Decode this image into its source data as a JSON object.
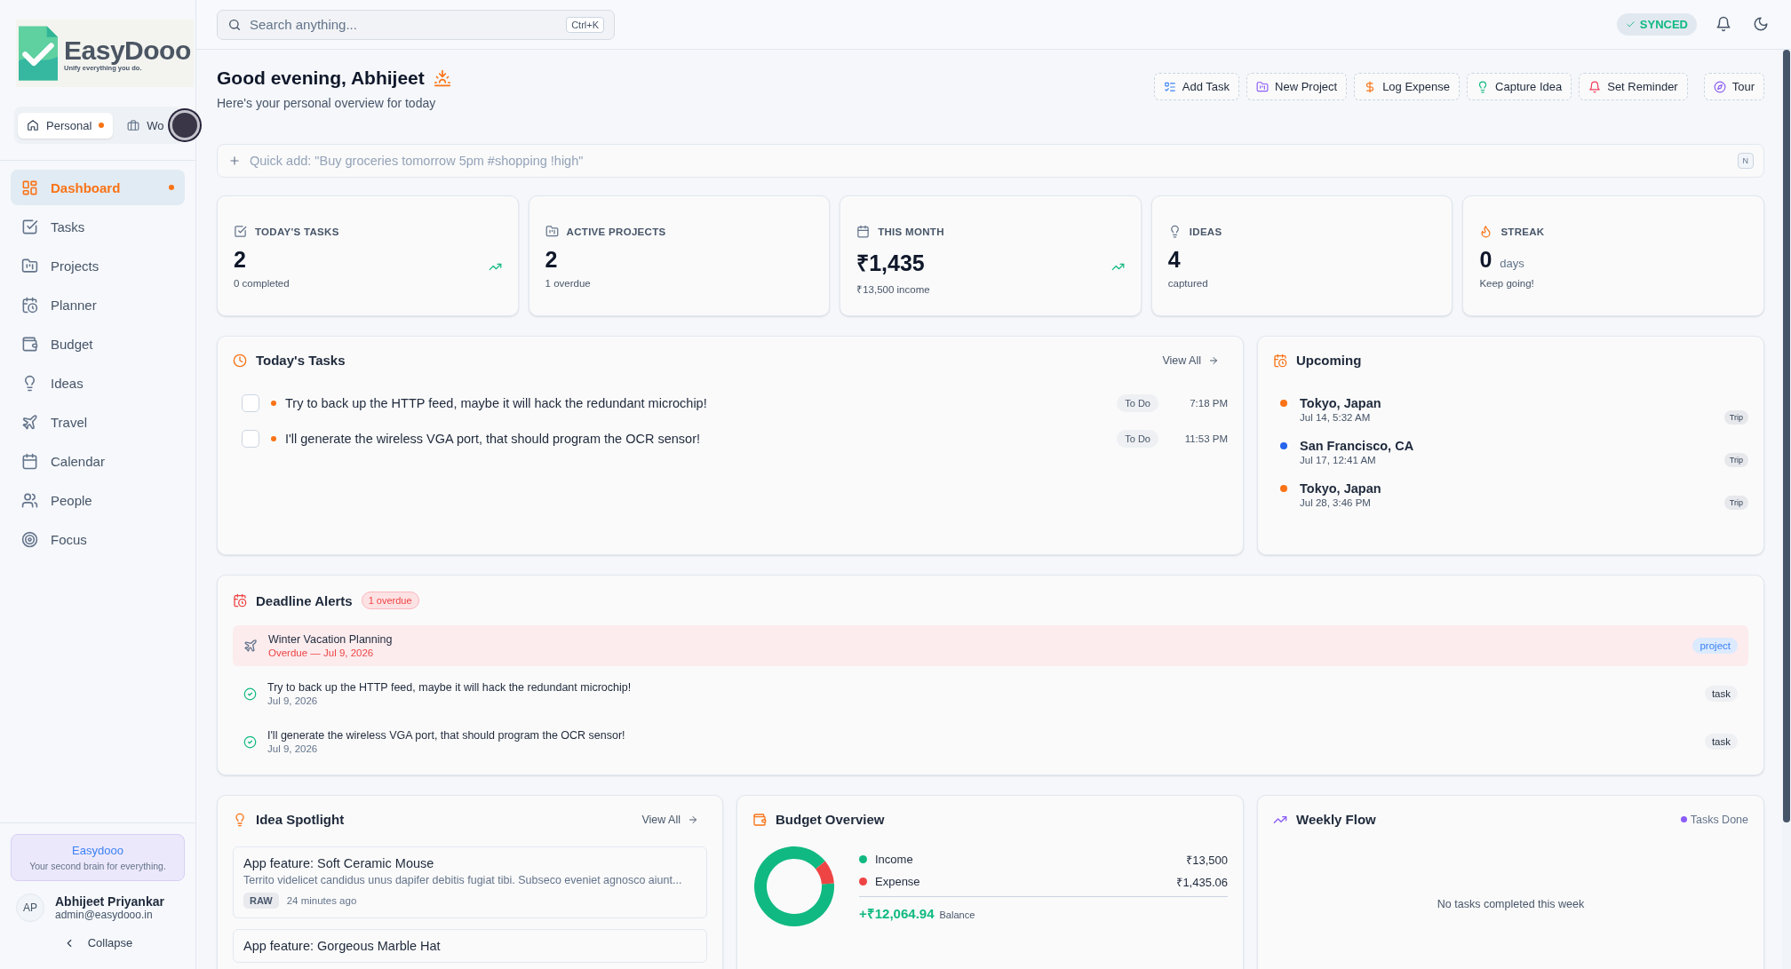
{
  "brand": {
    "name": "EasyDooo",
    "tagline": "Unify everything you do."
  },
  "workspaces": [
    {
      "label": "Personal",
      "selected": true,
      "unread": true
    },
    {
      "label": "Wo",
      "selected": false,
      "unread": false
    }
  ],
  "nav": [
    {
      "label": "Dashboard",
      "selected": true,
      "unread": true
    },
    {
      "label": "Tasks",
      "selected": false,
      "unread": false
    },
    {
      "label": "Projects",
      "selected": false,
      "unread": false
    },
    {
      "label": "Planner",
      "selected": false,
      "unread": false
    },
    {
      "label": "Budget",
      "selected": false,
      "unread": false
    },
    {
      "label": "Ideas",
      "selected": false,
      "unread": false
    },
    {
      "label": "Travel",
      "selected": false,
      "unread": false
    },
    {
      "label": "Calendar",
      "selected": false,
      "unread": false
    },
    {
      "label": "People",
      "selected": false,
      "unread": false
    },
    {
      "label": "Focus",
      "selected": false,
      "unread": false
    }
  ],
  "promo": {
    "title": "Easydooo",
    "text": "Your second brain for everything."
  },
  "user": {
    "initials": "AP",
    "name": "Abhijeet Priyankar",
    "email": "admin@easydooo.in"
  },
  "collapse": "Collapse",
  "search": {
    "placeholder": "Search anything...",
    "shortcut": "Ctrl+K"
  },
  "sync": "SYNCED",
  "greeting": {
    "title": "Good evening, Abhijeet",
    "subtitle": "Here's your personal overview for today"
  },
  "actions": [
    {
      "label": "Add Task"
    },
    {
      "label": "New Project"
    },
    {
      "label": "Log Expense"
    },
    {
      "label": "Capture Idea"
    },
    {
      "label": "Set Reminder"
    },
    {
      "label": "Tour"
    }
  ],
  "quick_add": {
    "placeholder": "Quick add: \"Buy groceries tomorrow 5pm #shopping !high\"",
    "shortcut": "N"
  },
  "stats": [
    {
      "label": "TODAY'S TASKS",
      "value": "2",
      "note": "0 completed",
      "trend": true
    },
    {
      "label": "ACTIVE PROJECTS",
      "value": "2",
      "note": "1 overdue",
      "trend": false
    },
    {
      "label": "THIS MONTH",
      "value": "₹1,435",
      "note": "₹13,500 income",
      "trend": true
    },
    {
      "label": "IDEAS",
      "value": "4",
      "note": "captured",
      "trend": false
    },
    {
      "label": "STREAK",
      "value": "0",
      "unit": "days",
      "note": "Keep going!",
      "trend": false
    }
  ],
  "today_tasks": {
    "title": "Today's Tasks",
    "view_all": "View All",
    "items": [
      {
        "text": "Try to back up the HTTP feed, maybe it will hack the redundant microchip!",
        "status": "To Do",
        "time": "7:18 PM",
        "checked": false,
        "color": "#f97316"
      },
      {
        "text": "I'll generate the wireless VGA port, that should program the OCR sensor!",
        "status": "To Do",
        "time": "11:53 PM",
        "checked": false,
        "color": "#f97316"
      }
    ]
  },
  "upcoming": {
    "title": "Upcoming",
    "items": [
      {
        "title": "Tokyo, Japan",
        "time": "Jul 14, 5:32 AM",
        "tag": "Trip",
        "color": "#f97316"
      },
      {
        "title": "San Francisco, CA",
        "time": "Jul 17, 12:41 AM",
        "tag": "Trip",
        "color": "#2563eb"
      },
      {
        "title": "Tokyo, Japan",
        "time": "Jul 28, 3:46 PM",
        "tag": "Trip",
        "color": "#f97316"
      }
    ]
  },
  "deadlines": {
    "title": "Deadline Alerts",
    "badge": "1 overdue",
    "items": [
      {
        "kind": "project",
        "title": "Winter Vacation Planning",
        "date": "Overdue — Jul 9, 2026",
        "tag": "project",
        "overdue": true
      },
      {
        "kind": "task",
        "title": "Try to back up the HTTP feed, maybe it will hack the redundant microchip!",
        "date": "Jul 9, 2026",
        "tag": "task",
        "overdue": false
      },
      {
        "kind": "task",
        "title": "I'll generate the wireless VGA port, that should program the OCR sensor!",
        "date": "Jul 9, 2026",
        "tag": "task",
        "overdue": false
      }
    ]
  },
  "ideas": {
    "title": "Idea Spotlight",
    "view_all": "View All",
    "items": [
      {
        "title": "App feature: Soft Ceramic Mouse",
        "text": "Territo videlicet candidus unus dapifer debitis fugiat tibi. Subseco eveniet agnosco aiunt...",
        "tag": "RAW",
        "time": "24 minutes ago"
      },
      {
        "title": "App feature: Gorgeous Marble Hat"
      }
    ]
  },
  "budget": {
    "title": "Budget Overview",
    "legend": [
      {
        "amount": "₹13,500",
        "color": "#10b981"
      },
      {
        "amount": "₹1,435.06",
        "color": "#ef4444"
      }
    ],
    "balance": "+₹12,064.94",
    "balance_label": "Balance",
    "chart_data": {
      "type": "donut",
      "categories": [
        "Income",
        "Expense"
      ],
      "values": [
        90.39,
        9.61
      ]
    }
  },
  "weekly": {
    "title": "Weekly Flow",
    "legend": {
      "label": "Tasks Done",
      "color": "#8b5cf6"
    },
    "empty": "No tasks completed this week"
  }
}
